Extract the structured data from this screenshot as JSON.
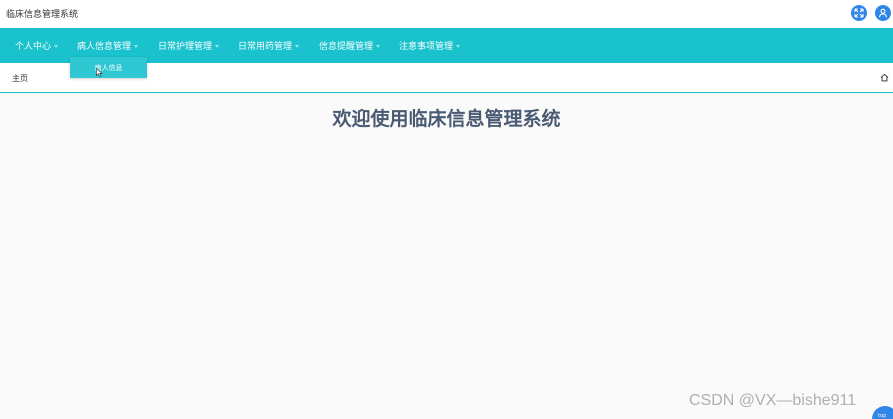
{
  "app": {
    "title": "临床信息管理系统"
  },
  "header": {
    "fullscreen_icon": "expand-arrows-icon",
    "user_icon": "user-icon"
  },
  "nav": {
    "items": [
      {
        "label": "个人中心"
      },
      {
        "label": "病人信息管理"
      },
      {
        "label": "日常护理管理"
      },
      {
        "label": "日常用药管理"
      },
      {
        "label": "信息提醒管理"
      },
      {
        "label": "注意事项管理"
      }
    ],
    "dropdown": {
      "items": [
        {
          "label": "病人信息"
        }
      ]
    }
  },
  "breadcrumb": {
    "text": "主页"
  },
  "main": {
    "welcome": "欢迎使用临床信息管理系统"
  },
  "watermark": {
    "text": "CSDN @VX—bishe911"
  },
  "corner": {
    "label": "top"
  },
  "colors": {
    "nav_bg": "#19c2cd",
    "dropdown_bg": "#2ec7d2",
    "icon_blue": "#2f86e6",
    "title_text": "#4a5a72"
  }
}
